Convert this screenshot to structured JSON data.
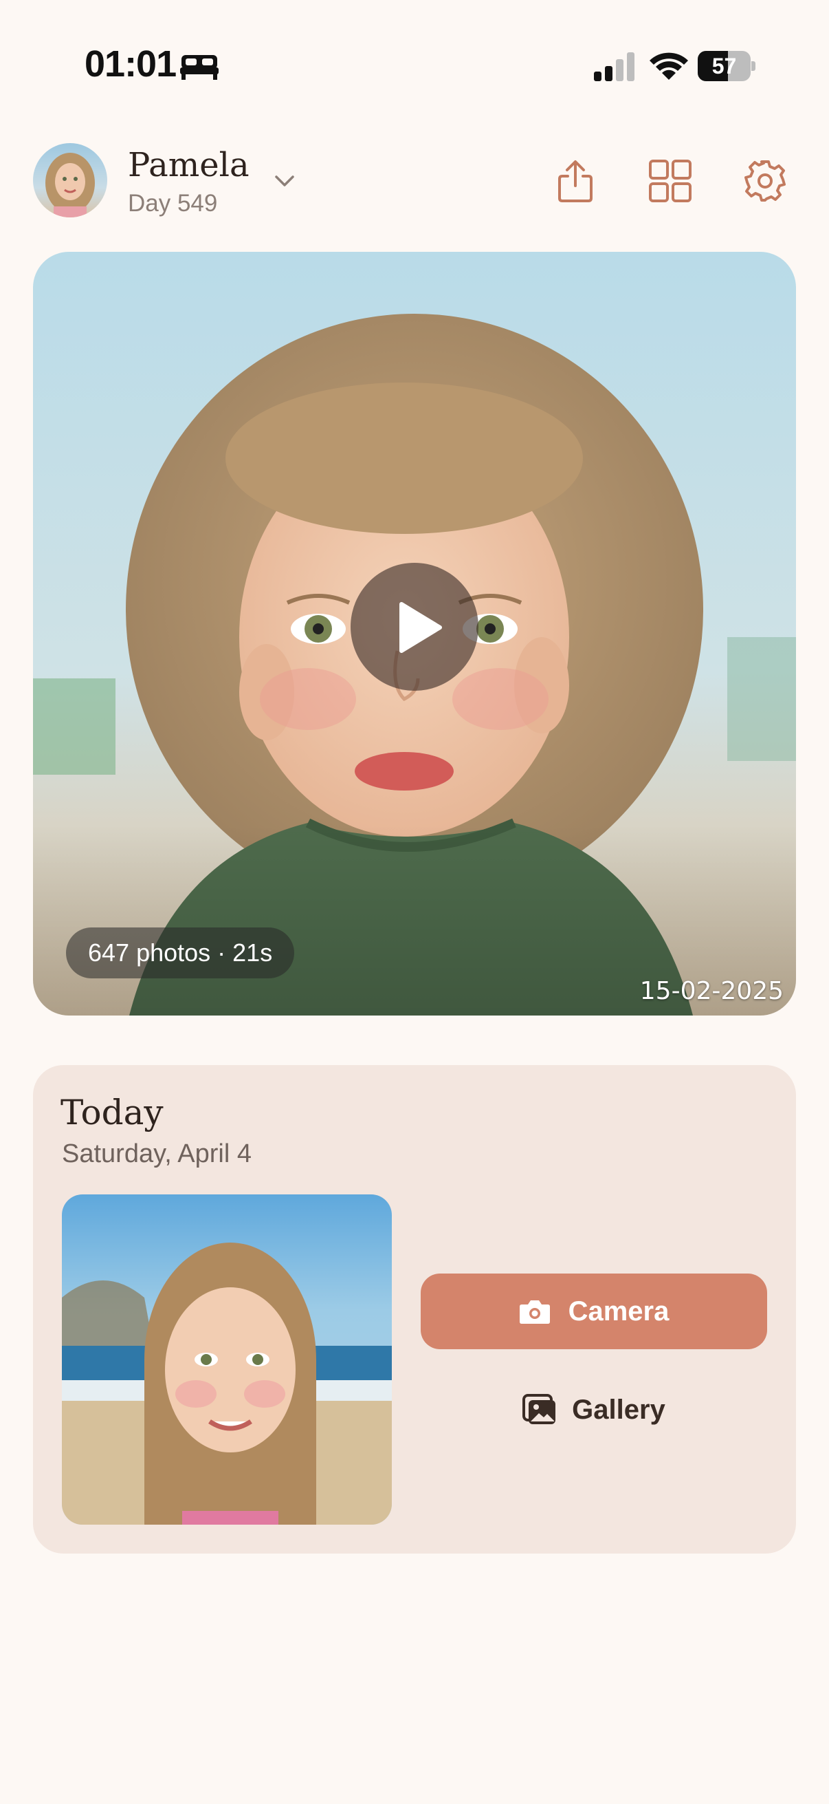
{
  "status_bar": {
    "time": "01:01",
    "battery": "57",
    "battery_level": 0.57,
    "icons": [
      "bed-icon",
      "cellular-signal-icon",
      "wifi-icon",
      "battery-icon"
    ]
  },
  "header": {
    "name": "Pamela",
    "day": "Day 549",
    "icons": [
      "avatar",
      "chevron-down-icon",
      "share-icon",
      "grid-icon",
      "gear-icon"
    ]
  },
  "hero": {
    "photos_info": "647 photos · 21s",
    "date": "15-02-2025",
    "icons": [
      "play-icon"
    ]
  },
  "today": {
    "title": "Today",
    "date": "Saturday, April 4",
    "camera_label": "Camera",
    "gallery_label": "Gallery",
    "icons": [
      "camera-icon",
      "gallery-icon"
    ]
  },
  "colors": {
    "background": "#fdf8f4",
    "accent": "#d4846b",
    "card": "#f3e6df",
    "icon": "#c27a5e"
  }
}
